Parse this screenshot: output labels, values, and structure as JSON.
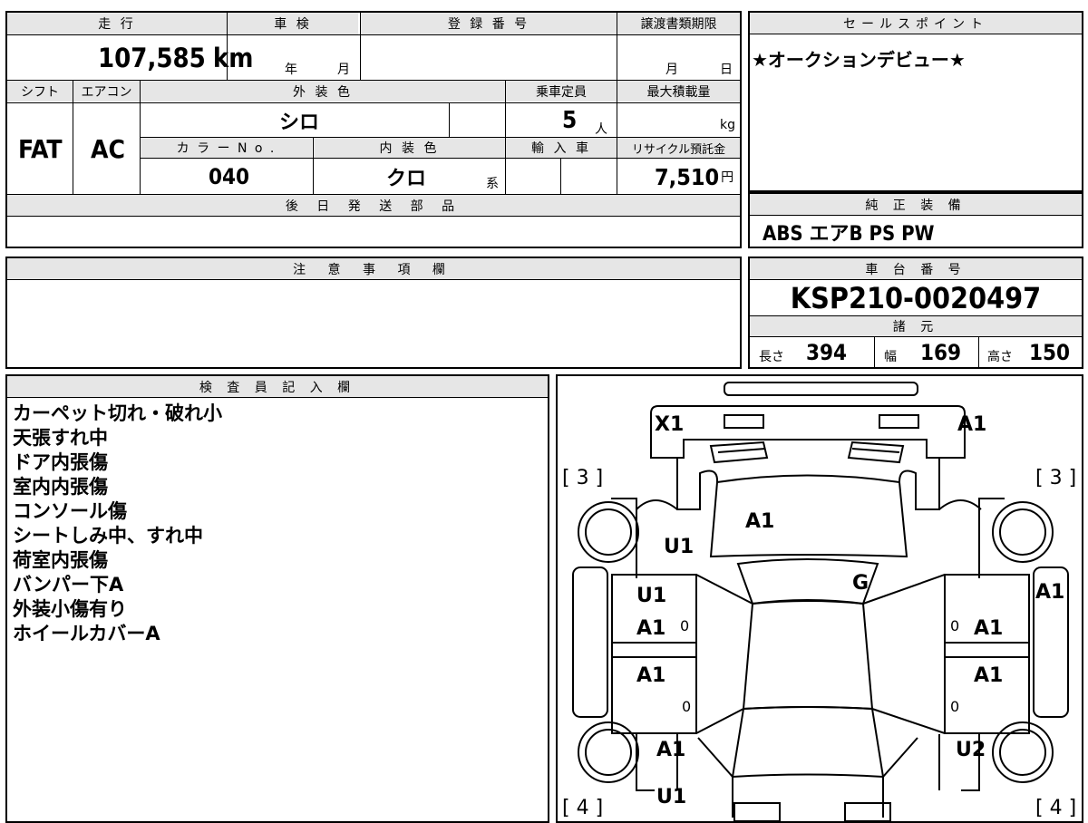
{
  "vehicle": {
    "mileage_header": "走 行",
    "mileage_value": "107,585",
    "mileage_unit": "km",
    "inspection_header": "車 検",
    "inspection_year_unit": "年",
    "inspection_month_unit": "月",
    "registration_header": "登 録 番 号",
    "transfer_header": "譲渡書類期限",
    "transfer_month_unit": "月",
    "transfer_day_unit": "日",
    "shift_header": "シフト",
    "shift_value": "FAT",
    "ac_header": "エアコン",
    "ac_value": "AC",
    "exterior_header": "外 装 色",
    "exterior_value": "シロ",
    "color_no_header": "カ ラ ー N o .",
    "color_no_value": "040",
    "interior_header": "内 装 色",
    "interior_value": "クロ",
    "interior_suffix": "系",
    "capacity_header": "乗車定員",
    "capacity_value": "5",
    "capacity_unit": "人",
    "max_load_header": "最大積載量",
    "max_load_unit": "kg",
    "import_header": "輸 入 車",
    "recycle_header": "リサイクル預託金",
    "recycle_value": "7,510",
    "recycle_unit": "円",
    "later_parts_header": "後 日 発 送 部 品"
  },
  "sales_point": {
    "header": "セールスポイント",
    "text": "★オークションデビュー★"
  },
  "equipment": {
    "header": "純 正 装 備",
    "text": "ABS エアB PS PW"
  },
  "caution": {
    "header": "注 意 事 項 欄"
  },
  "chassis": {
    "header": "車 台 番 号",
    "number": "KSP210-0020497",
    "specs_header": "諸 元",
    "length_label": "長さ",
    "length_value": "394",
    "width_label": "幅",
    "width_value": "169",
    "height_label": "高さ",
    "height_value": "150"
  },
  "inspector": {
    "header": "検 査 員 記 入 欄",
    "notes": [
      "カーペット切れ・破れ小",
      "天張すれ中",
      "ドア内張傷",
      "室内内張傷",
      "コンソール傷",
      "シートしみ中、すれ中",
      "荷室内張傷",
      "バンパー下A",
      "外装小傷有り",
      "ホイールカバーA"
    ]
  },
  "diagram": {
    "labels": {
      "front_left": "X1",
      "front_right": "A1",
      "bracket_tl": "[ 3 ]",
      "bracket_tr": "[ 3 ]",
      "hood": "A1",
      "front_fender_l": "U1",
      "windshield": "G",
      "front_door_l_upper": "U1",
      "front_door_l": "A1",
      "front_door_l_small": "0",
      "front_door_r_small": "0",
      "front_door_r": "A1",
      "fender_r": "A1",
      "rear_door_l": "A1",
      "rear_door_l_small": "0",
      "rear_door_r": "A1",
      "rear_door_r_small": "0",
      "rear_fender_l": "A1",
      "rear_fender_r": "U2",
      "rear_bumper_l": "U1",
      "bracket_bl": "[ 4 ]",
      "bracket_br": "[ 4 ]"
    }
  }
}
